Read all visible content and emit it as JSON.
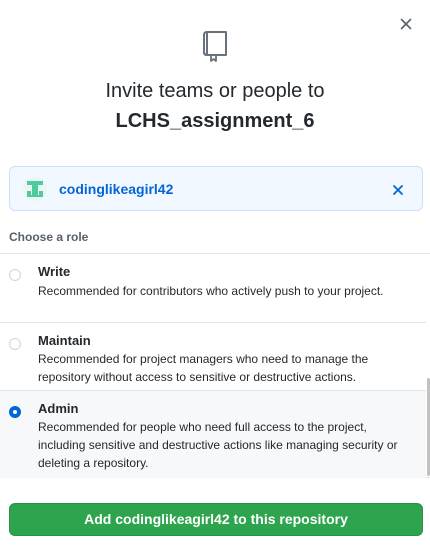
{
  "dialog": {
    "close_icon": "x-icon",
    "repo_icon": "repo-icon",
    "title_prefix": "Invite teams or people to",
    "repo_name": "LCHS_assignment_6"
  },
  "selected_user": {
    "avatar": "identicon",
    "username": "codinglikeagirl42",
    "remove_icon": "x-icon",
    "accent_color": "#0366d6"
  },
  "roles": {
    "heading": "Choose a role",
    "items": [
      {
        "name": "Write",
        "description": "Recommended for contributors who actively push to your project.",
        "selected": false
      },
      {
        "name": "Maintain",
        "description": "Recommended for project managers who need to manage the repository without access to sensitive or destructive actions.",
        "selected": false
      },
      {
        "name": "Admin",
        "description": "Recommended for people who need full access to the project, including sensitive and destructive actions like managing security or deleting a repository.",
        "selected": true
      }
    ]
  },
  "submit": {
    "label": "Add codinglikeagirl42 to this repository",
    "color": "#2ea44f"
  }
}
